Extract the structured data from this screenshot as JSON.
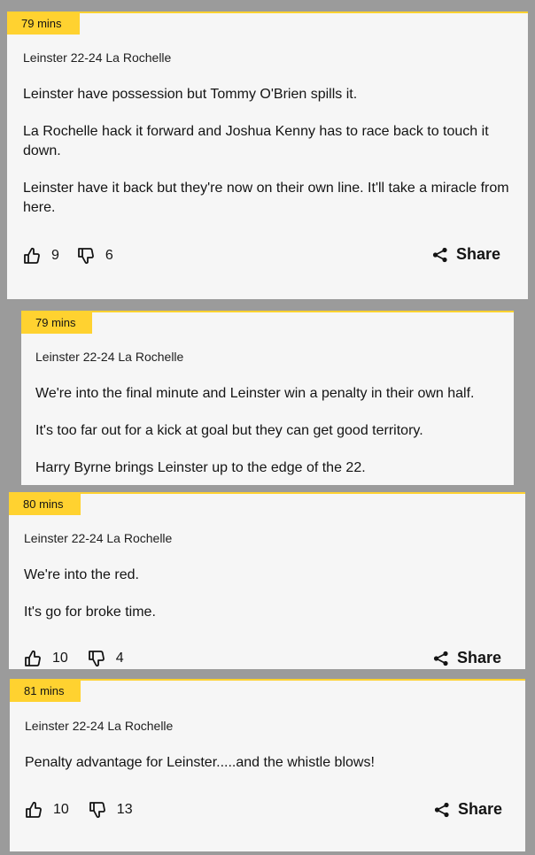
{
  "posts": [
    {
      "time": "79 mins",
      "score": "Leinster 22-24 La Rochelle",
      "paragraphs": [
        "Leinster have possession but Tommy O'Brien spills it.",
        "La Rochelle hack it forward and Joshua Kenny has to race back to touch it down.",
        "Leinster have it back but they're now on their own line. It'll take a miracle from here."
      ],
      "likes": "9",
      "dislikes": "6",
      "share_label": "Share"
    },
    {
      "time": "79 mins",
      "score": "Leinster 22-24 La Rochelle",
      "paragraphs": [
        "We're into the final minute and Leinster win a penalty in their own half.",
        "It's too far out for a kick at goal but they can get good territory.",
        "Harry Byrne brings Leinster up to the edge of the 22."
      ]
    },
    {
      "time": "80 mins",
      "score": "Leinster 22-24 La Rochelle",
      "paragraphs": [
        "We're into the red.",
        "It's go for broke time."
      ],
      "likes": "10",
      "dislikes": "4",
      "share_label": "Share"
    },
    {
      "time": "81 mins",
      "score": "Leinster 22-24 La Rochelle",
      "paragraphs": [
        "Penalty advantage for Leinster.....and the whistle blows!"
      ],
      "likes": "10",
      "dislikes": "13",
      "share_label": "Share"
    }
  ],
  "colors": {
    "accent": "#ffd230",
    "card_bg": "#f6f6f6",
    "page_bg": "#9b9b9b",
    "text": "#141414"
  },
  "icons": {
    "like": "thumbs-up-icon",
    "dislike": "thumbs-down-icon",
    "share": "share-icon"
  }
}
